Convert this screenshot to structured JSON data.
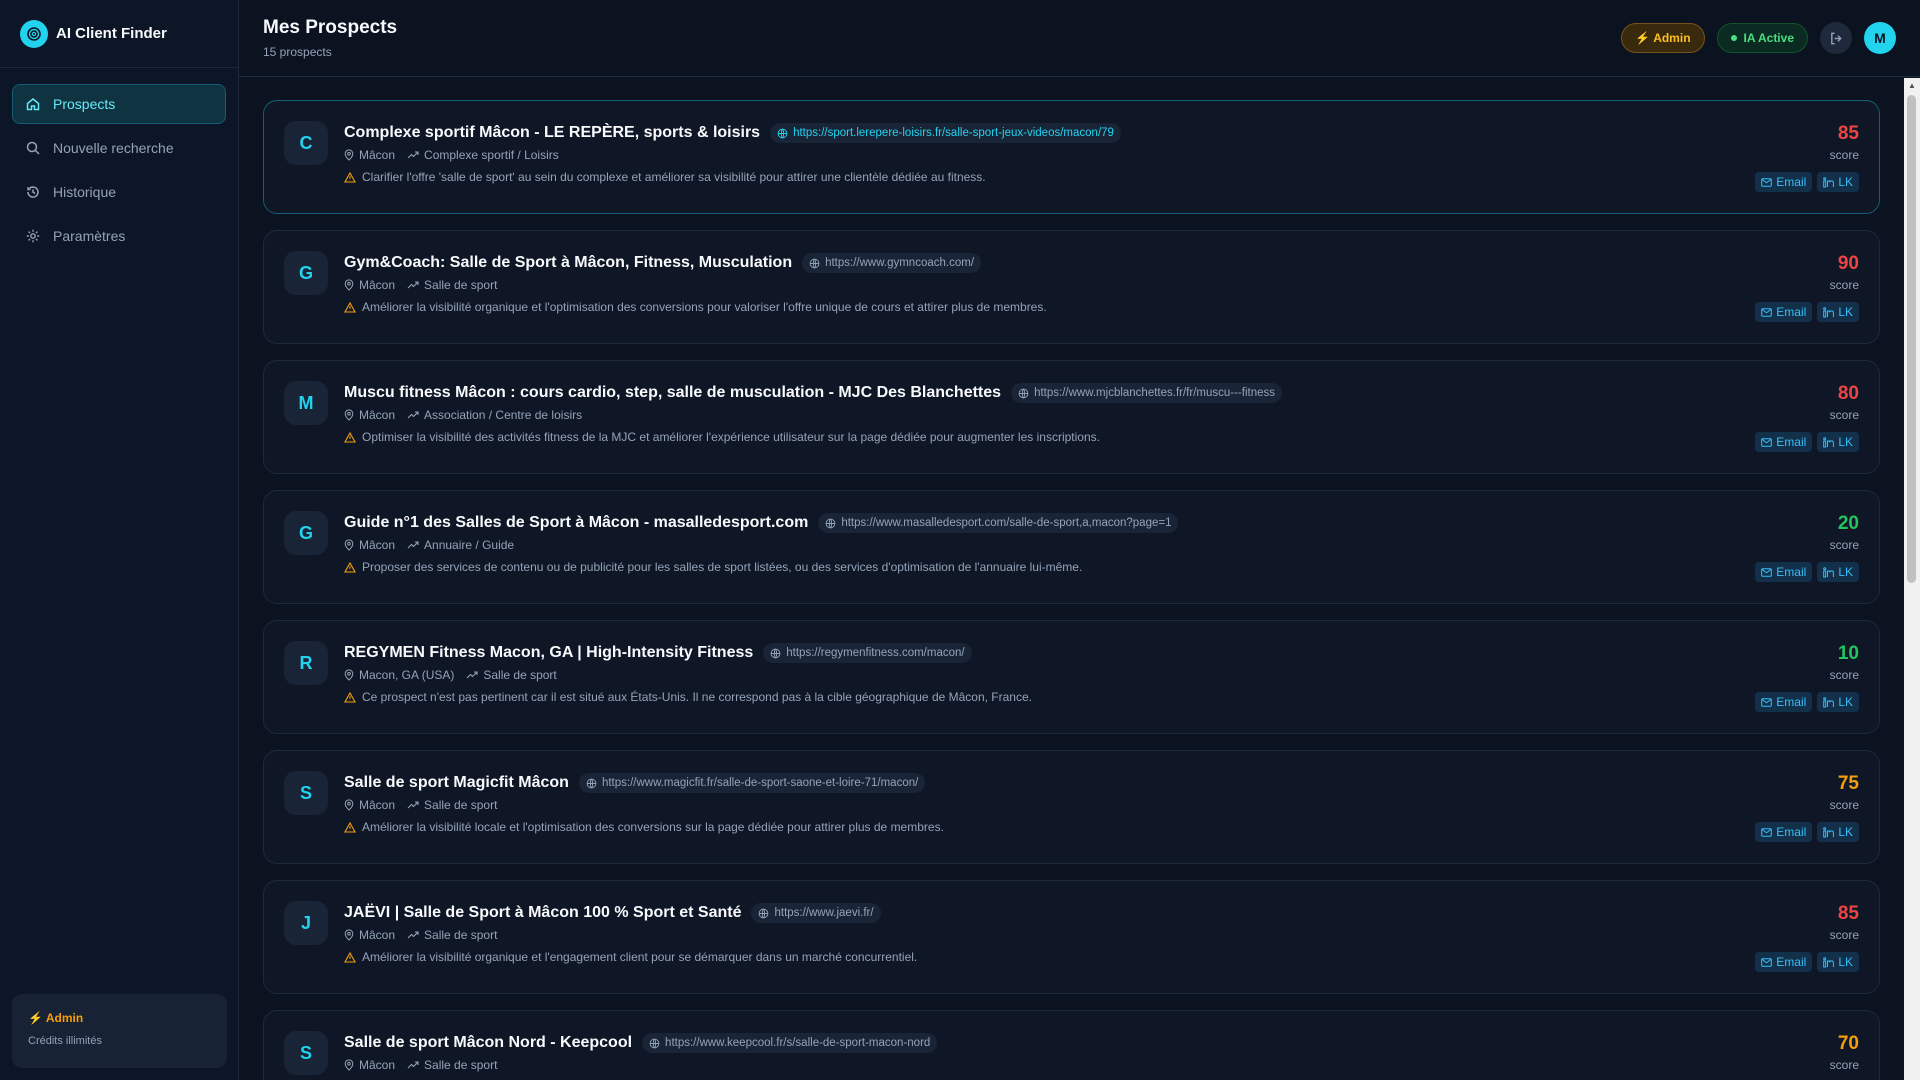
{
  "app": {
    "title": "AI Client Finder"
  },
  "sidebar": {
    "items": [
      {
        "label": "Prospects",
        "icon": "home-icon",
        "active": true
      },
      {
        "label": "Nouvelle recherche",
        "icon": "search-icon"
      },
      {
        "label": "Historique",
        "icon": "history-icon"
      },
      {
        "label": "Paramètres",
        "icon": "gear-icon"
      }
    ],
    "credit": {
      "role": "⚡ Admin",
      "text": "Crédits illimités"
    }
  },
  "header": {
    "title": "Mes Prospects",
    "subtitle": "15 prospects",
    "admin_badge": "⚡ Admin",
    "ai_badge": "IA Active",
    "avatar_letter": "M"
  },
  "actions": {
    "email": "Email",
    "linkedin": "LK"
  },
  "score_label": "score",
  "colors": {
    "accent": "#22d3ee",
    "high": "#ef4444",
    "mid": "#f59e0b",
    "low": "#22c55e"
  },
  "prospects": [
    {
      "initial": "C",
      "name": "Complexe sportif Mâcon - LE REPÈRE, sports & loisirs",
      "url": "https://sport.lerepere-loisirs.fr/salle-sport-jeux-videos/macon/79",
      "location": "Mâcon",
      "category": "Complexe sportif / Loisirs",
      "insight": "Clarifier l'offre 'salle de sport' au sein du complexe et améliorer sa visibilité pour attirer une clientèle dédiée au fitness.",
      "score": "85",
      "level": "red"
    },
    {
      "initial": "G",
      "name": "Gym&Coach: Salle de Sport à Mâcon, Fitness, Musculation",
      "url": "https://www.gymncoach.com/",
      "location": "Mâcon",
      "category": "Salle de sport",
      "insight": "Améliorer la visibilité organique et l'optimisation des conversions pour valoriser l'offre unique de cours et attirer plus de membres.",
      "score": "90",
      "level": "red"
    },
    {
      "initial": "M",
      "name": "Muscu fitness Mâcon : cours cardio, step, salle de musculation - MJC Des Blanchettes",
      "url": "https://www.mjcblanchettes.fr/fr/muscu---fitness",
      "location": "Mâcon",
      "category": "Association / Centre de loisirs",
      "insight": "Optimiser la visibilité des activités fitness de la MJC et améliorer l'expérience utilisateur sur la page dédiée pour augmenter les inscriptions.",
      "score": "80",
      "level": "red"
    },
    {
      "initial": "G",
      "name": "Guide n°1 des Salles de Sport à Mâcon - masalledesport.com",
      "url": "https://www.masalledesport.com/salle-de-sport,a,macon?page=1",
      "location": "Mâcon",
      "category": "Annuaire / Guide",
      "insight": "Proposer des services de contenu ou de publicité pour les salles de sport listées, ou des services d'optimisation de l'annuaire lui-même.",
      "score": "20",
      "level": "green"
    },
    {
      "initial": "R",
      "name": "REGYMEN Fitness Macon, GA | High-Intensity Fitness",
      "url": "https://regymenfitness.com/macon/",
      "location": "Macon, GA (USA)",
      "category": "Salle de sport",
      "insight": "Ce prospect n'est pas pertinent car il est situé aux États-Unis. Il ne correspond pas à la cible géographique de Mâcon, France.",
      "score": "10",
      "level": "green"
    },
    {
      "initial": "S",
      "name": "Salle de sport Magicfit Mâcon",
      "url": "https://www.magicfit.fr/salle-de-sport-saone-et-loire-71/macon/",
      "location": "Mâcon",
      "category": "Salle de sport",
      "insight": "Améliorer la visibilité locale et l'optimisation des conversions sur la page dédiée pour attirer plus de membres.",
      "score": "75",
      "level": "orange"
    },
    {
      "initial": "J",
      "name": "JAËVI | Salle de Sport à Mâcon 100 % Sport et Santé",
      "url": "https://www.jaevi.fr/",
      "location": "Mâcon",
      "category": "Salle de sport",
      "insight": "Améliorer la visibilité organique et l'engagement client pour se démarquer dans un marché concurrentiel.",
      "score": "85",
      "level": "red"
    },
    {
      "initial": "S",
      "name": "Salle de sport Mâcon Nord - Keepcool",
      "url": "https://www.keepcool.fr/s/salle-de-sport-macon-nord",
      "location": "Mâcon",
      "category": "Salle de sport",
      "insight": "",
      "score": "70",
      "level": "orange"
    }
  ]
}
